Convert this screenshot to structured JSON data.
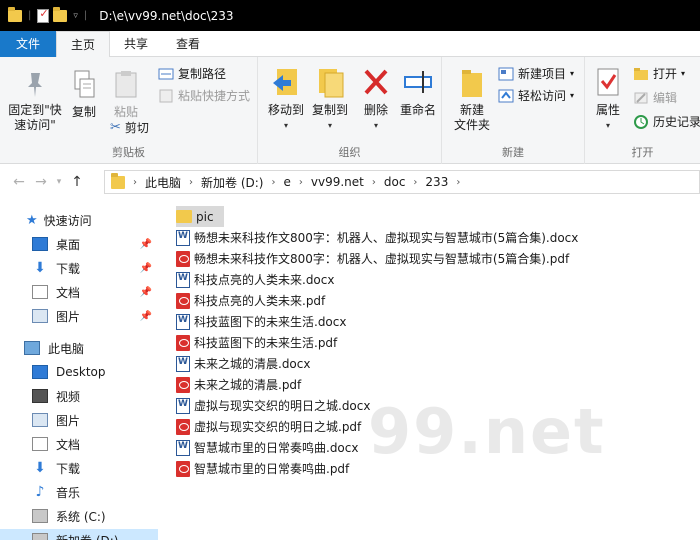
{
  "titlebar": {
    "path": "D:\\e\\vv99.net\\doc\\233"
  },
  "tabs": [
    "文件",
    "主页",
    "共享",
    "查看"
  ],
  "ribbon": {
    "clipboard": {
      "pin": "固定到\"快\n速访问\"",
      "copy": "复制",
      "paste": "粘贴",
      "copy_path": "复制路径",
      "paste_shortcut": "粘贴快捷方式",
      "cut": "剪切",
      "label": "剪贴板"
    },
    "organize": {
      "move_to": "移动到",
      "copy_to": "复制到",
      "delete": "删除",
      "rename": "重命名",
      "label": "组织"
    },
    "new": {
      "new_folder": "新建\n文件夹",
      "new_item": "新建项目",
      "easy_access": "轻松访问",
      "label": "新建"
    },
    "open": {
      "properties": "属性",
      "open": "打开",
      "edit": "编辑",
      "history": "历史记录",
      "label": "打开"
    }
  },
  "address": {
    "crumbs": [
      "此电脑",
      "新加卷 (D:)",
      "e",
      "vv99.net",
      "doc",
      "233"
    ]
  },
  "sidebar": {
    "quick_access": "快速访问",
    "quick_items": [
      "桌面",
      "下载",
      "文档",
      "图片"
    ],
    "this_pc": "此电脑",
    "pc_items": [
      "Desktop",
      "视频",
      "图片",
      "文档",
      "下载",
      "音乐",
      "系统 (C:)",
      "新加卷 (D:)"
    ]
  },
  "files": [
    {
      "name": "pic",
      "type": "folder"
    },
    {
      "name": "畅想未来科技作文800字：机器人、虚拟现实与智慧城市(5篇合集).docx",
      "type": "docx"
    },
    {
      "name": "畅想未来科技作文800字：机器人、虚拟现实与智慧城市(5篇合集).pdf",
      "type": "pdf"
    },
    {
      "name": "科技点亮的人类未来.docx",
      "type": "docx"
    },
    {
      "name": "科技点亮的人类未来.pdf",
      "type": "pdf"
    },
    {
      "name": "科技蓝图下的未来生活.docx",
      "type": "docx"
    },
    {
      "name": "科技蓝图下的未来生活.pdf",
      "type": "pdf"
    },
    {
      "name": "未来之城的清晨.docx",
      "type": "docx"
    },
    {
      "name": "未来之城的清晨.pdf",
      "type": "pdf"
    },
    {
      "name": "虚拟与现实交织的明日之城.docx",
      "type": "docx"
    },
    {
      "name": "虚拟与现实交织的明日之城.pdf",
      "type": "pdf"
    },
    {
      "name": "智慧城市里的日常奏鸣曲.docx",
      "type": "docx"
    },
    {
      "name": "智慧城市里的日常奏鸣曲.pdf",
      "type": "pdf"
    }
  ],
  "watermark": "99.net"
}
